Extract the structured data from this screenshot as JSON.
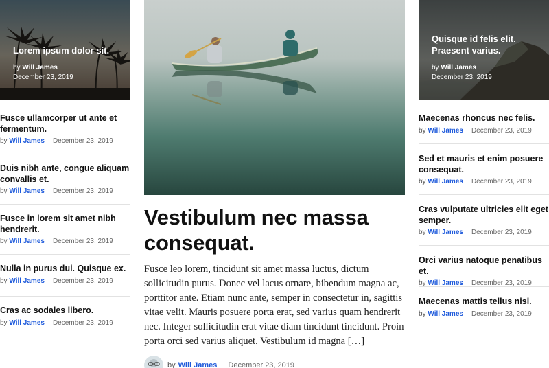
{
  "left": {
    "hero": {
      "title": "Lorem ipsum dolor sit.",
      "by": "by",
      "author": "Will James",
      "date": "December 23, 2019"
    },
    "items": [
      {
        "title": "Fusce ullamcorper ut ante et fermentum.",
        "by": "by",
        "author": "Will James",
        "date": "December 23, 2019"
      },
      {
        "title": "Duis nibh ante, congue aliquam convallis et.",
        "by": "by",
        "author": "Will James",
        "date": "December 23, 2019"
      },
      {
        "title": "Fusce in lorem sit amet nibh hendrerit.",
        "by": "by",
        "author": "Will James",
        "date": "December 23, 2019"
      },
      {
        "title": "Nulla in purus dui. Quisque ex.",
        "by": "by",
        "author": "Will James",
        "date": "December 23, 2019"
      },
      {
        "title": "Cras ac sodales libero.",
        "by": "by",
        "author": "Will James",
        "date": "December 23, 2019"
      }
    ]
  },
  "main": {
    "title": "Vestibulum nec massa consequat.",
    "excerpt": "Fusce leo lorem, tincidunt sit amet massa luctus, dictum sollicitudin purus. Donec vel lacus ornare, bibendum magna ac, porttitor ante. Etiam nunc ante, semper in consectetur in, sagittis vitae velit. Mauris posuere porta erat, sed varius quam hendrerit nec. Integer sollicitudin erat vitae diam tincidunt tincidunt. Proin porta orci sed varius aliquet. Vestibulum id magna […]",
    "by": "by",
    "author": "Will James",
    "date": "December 23, 2019"
  },
  "right": {
    "hero": {
      "title": "Quisque id felis elit. Praesent varius.",
      "by": "by",
      "author": "Will James",
      "date": "December 23, 2019"
    },
    "items": [
      {
        "title": "Maecenas rhoncus nec felis.",
        "by": "by",
        "author": "Will James",
        "date": "December 23, 2019"
      },
      {
        "title": "Sed et mauris et enim posuere consequat.",
        "by": "by",
        "author": "Will James",
        "date": "December 23, 2019"
      },
      {
        "title": "Cras vulputate ultricies elit eget semper.",
        "by": "by",
        "author": "Will James",
        "date": "December 23, 2019"
      },
      {
        "title": "Orci varius natoque penatibus et.",
        "by": "by",
        "author": "Will James",
        "date": "December 23, 2019"
      },
      {
        "title": "Maecenas mattis tellus nisl.",
        "by": "by",
        "author": "Will James",
        "date": "December 23, 2019"
      }
    ]
  },
  "colors": {
    "link": "#1e5adb",
    "divider": "#e2e2e2"
  },
  "images": {
    "left_hero": "palm-trees-sunset",
    "main": "canoe-on-misty-lake",
    "right_hero": "mountain-coast",
    "avatar": "author-avatar"
  }
}
